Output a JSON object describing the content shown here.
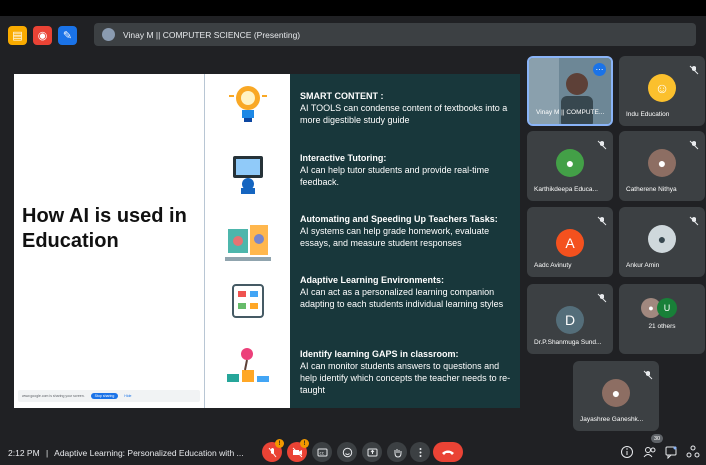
{
  "topbar": {
    "presenting_label": "Vinay M || COMPUTER SCIENCE (Presenting)"
  },
  "slide": {
    "title": "How AI is used in Education",
    "share_notice": "www.google.com is sharing your screen.",
    "stop_sharing_label": "Stop sharing",
    "hide_label": "Hide",
    "sections": [
      {
        "heading": "SMART CONTENT :",
        "body": "AI TOOLS can condense  content of textbooks into a more digestible study guide"
      },
      {
        "heading": "Interactive Tutoring:",
        "body": "AI can help tutor students and provide real-time feedback."
      },
      {
        "heading": "Automating and Speeding Up Teachers Tasks:",
        "body": "AI systems can help grade homework, evaluate essays, and measure student responses"
      },
      {
        "heading": "Adaptive Learning Environments:",
        "body": "AI can act as a personalized learning companion adapting to each students individual learning styles"
      },
      {
        "heading": "Identify learning GAPS in classroom:",
        "body": "AI can monitor students answers to questions and help identify which concepts the teacher needs to re-taught"
      }
    ]
  },
  "participants": [
    {
      "name": "Vinay M || COMPUTE...",
      "icon": "more-icon"
    },
    {
      "name": "Indu Education",
      "icon": "mic-off-icon"
    },
    {
      "name": "Karthikdeepa Educa...",
      "icon": "mic-off-icon"
    },
    {
      "name": "Catherene Nithya",
      "icon": "mic-off-icon"
    },
    {
      "name": "Aadc Avinuty",
      "icon": "mic-off-icon",
      "initial": "A",
      "color": "#f4511e"
    },
    {
      "name": "Ankur Amin",
      "icon": "mic-off-icon"
    },
    {
      "name": "Dr.P.Shanmuga Sund...",
      "icon": "mic-off-icon",
      "initial": "D",
      "color": "#546e7a"
    },
    {
      "name": "21 others",
      "initial": "U",
      "color": "#188038"
    },
    {
      "name": "Jayashree Ganeshk...",
      "icon": "mic-off-icon"
    }
  ],
  "bottom": {
    "time": "2:12 PM",
    "separator": "|",
    "meeting_title": "Adaptive Learning: Personalized Education with ...",
    "mic_badge": "!",
    "cam_badge": "!",
    "people_count": "30"
  },
  "colors": {
    "accent": "#8ab4f8",
    "end_call": "#ea4335",
    "warning": "#f29900",
    "slide_panel": "#18373b"
  }
}
